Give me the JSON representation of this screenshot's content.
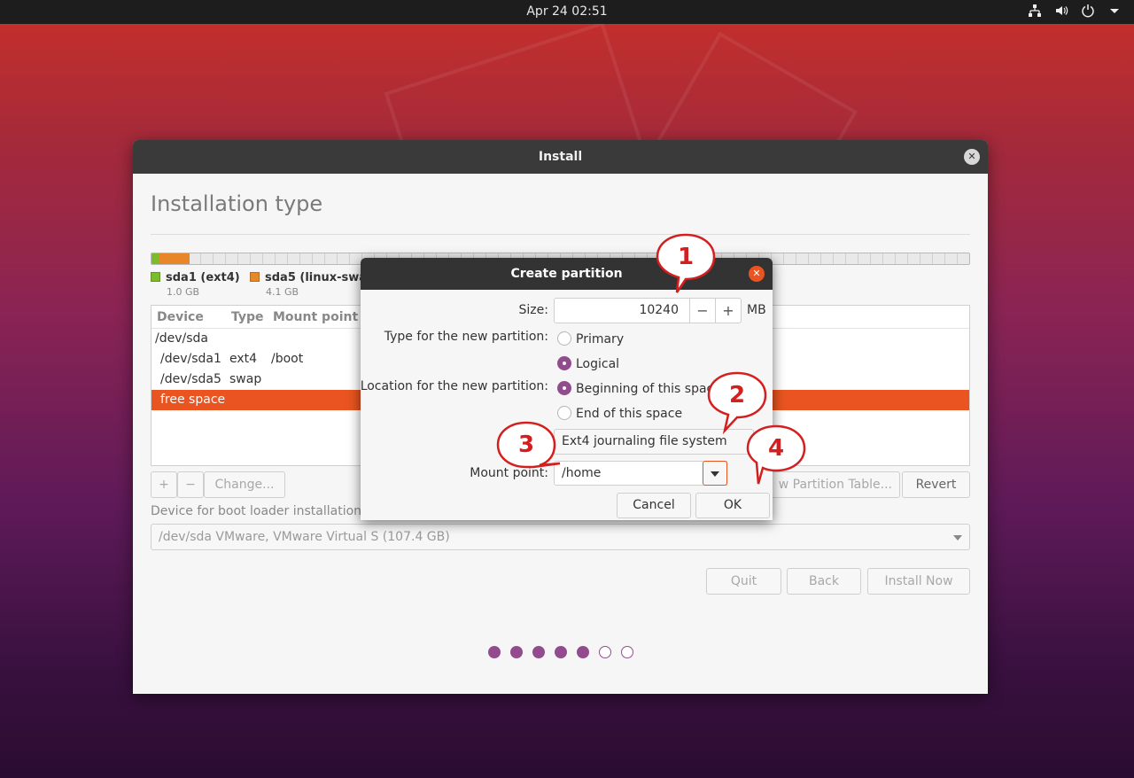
{
  "topbar": {
    "clock": "Apr 24  02:51",
    "tray_icons": [
      "network-icon",
      "volume-icon",
      "power-icon",
      "chevron-down-icon"
    ]
  },
  "window": {
    "title": "Install",
    "page_title": "Installation type",
    "legend": [
      {
        "name": "sda1 (ext4)",
        "size": "1.0 GB",
        "color": "#7cbb2c"
      },
      {
        "name": "sda5 (linux-swa",
        "size": "4.1 GB",
        "color": "#e8862a"
      }
    ],
    "table": {
      "headers": [
        "Device",
        "Type",
        "Mount point"
      ],
      "rows": [
        {
          "device": "/dev/sda",
          "type": "",
          "mount": ""
        },
        {
          "device": "/dev/sda1",
          "type": "ext4",
          "mount": "/boot"
        },
        {
          "device": "/dev/sda5",
          "type": "swap",
          "mount": ""
        },
        {
          "device": "free space",
          "type": "",
          "mount": ""
        }
      ]
    },
    "buttons": {
      "add": "+",
      "remove": "−",
      "change": "Change...",
      "new_table": "w Partition Table...",
      "revert": "Revert",
      "quit": "Quit",
      "back": "Back",
      "install_now": "Install Now"
    },
    "boot_label": "Device for boot loader installation:",
    "boot_device": "/dev/sda   VMware, VMware Virtual S (107.4 GB)",
    "progress": {
      "total_steps": 7,
      "completed_steps": 5
    },
    "accent": "#e95420",
    "step_color": "#924c8e"
  },
  "dialog": {
    "title": "Create partition",
    "size_label": "Size:",
    "size_value": "10240",
    "size_unit": "MB",
    "type_label": "Type for the new partition:",
    "type_primary": "Primary",
    "type_logical": "Logical",
    "location_label": "Location for the new partition:",
    "location_beginning": "Beginning of this space",
    "location_end": "End of this space",
    "use_as_value": "Ext4 journaling file system",
    "mount_label": "Mount point:",
    "mount_value": "/home",
    "cancel": "Cancel",
    "ok": "OK"
  },
  "callouts": [
    "1",
    "2",
    "3",
    "4"
  ]
}
